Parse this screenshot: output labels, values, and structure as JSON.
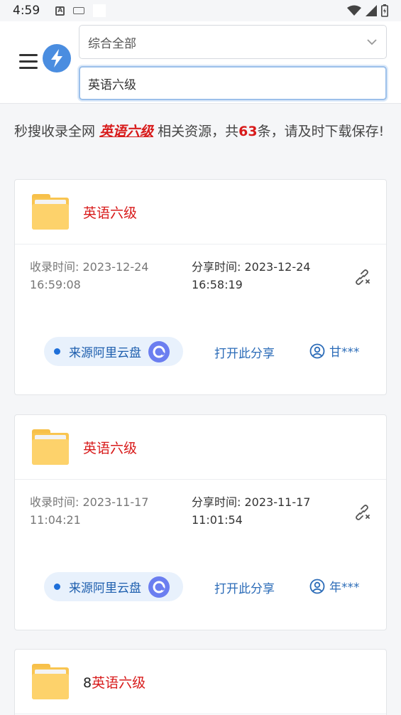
{
  "status_bar": {
    "time": "4:59",
    "icons": [
      "a-notification-icon",
      "keyboard-icon",
      "wifi-icon",
      "signal-icon",
      "battery-icon"
    ]
  },
  "header": {
    "category_select": {
      "value": "综合全部"
    },
    "search": {
      "value": "英语六级"
    }
  },
  "summary": {
    "prefix": "秒搜收录全网 ",
    "keyword": "英语六级",
    "middle": " 相关资源，共",
    "count": "63",
    "suffix": "条，请及时下载保存!"
  },
  "results": [
    {
      "title": "英语六级",
      "collect_time": "收录时间: 2023-12-24 16:59:08",
      "share_time": "分享时间: 2023-12-24 16:58:19",
      "source": "来源阿里云盘",
      "open": "打开此分享",
      "user": "甘***"
    },
    {
      "title": "英语六级",
      "collect_time": "收录时间: 2023-11-17 11:04:21",
      "share_time": "分享时间: 2023-11-17 11:01:54",
      "source": "来源阿里云盘",
      "open": "打开此分享",
      "user": "年***"
    },
    {
      "title_prefix": "8",
      "title": "英语六级"
    }
  ],
  "colors": {
    "accent": "#d81b1b",
    "link": "#2c6cb8",
    "logo": "#4a8de0",
    "folder": "#fdd26b"
  }
}
